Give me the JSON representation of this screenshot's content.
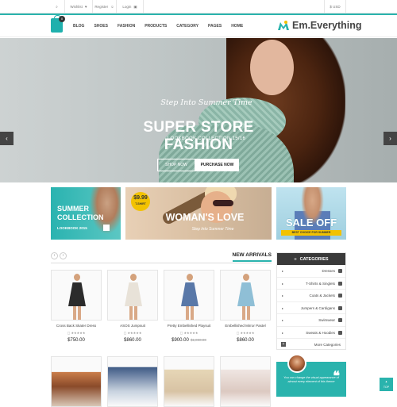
{
  "topbar": {
    "wishlist": "Wishlist",
    "register": "Register",
    "login": "Login",
    "currency": "$ USD"
  },
  "nav": {
    "cart_count": "0",
    "items": [
      "BLOG",
      "SHOES",
      "FASHION",
      "PRODUCTS",
      "CATEGORY",
      "PAGES",
      "HOME"
    ],
    "logo": "Em.Everything"
  },
  "hero": {
    "subtitle": "Step Into Summer Time",
    "title": "SUPER STORE FASHION",
    "collection": "LOOKBOOK COLLECTION 15/16",
    "shop_now": "SHOP NOW",
    "purchase_now": "PURCHASE NOW",
    "active_slide": 2,
    "slide_count": 3
  },
  "banners": {
    "summer": {
      "title_line1": "SUMMER",
      "title_line2": "COLLECTION",
      "subtitle": "LOOKBOOK 2015"
    },
    "woman": {
      "price": "$9.99",
      "price_label": "T-SHIRT",
      "title": "WOMAN'S LOVE",
      "subtitle": "Step Into Summer Time"
    },
    "sale": {
      "title": "SALE OFF",
      "subtitle": "BEST CHOICE FOR SUMMER"
    }
  },
  "section": {
    "title": "NEW ARRIVALS",
    "prev": "‹",
    "next": "›"
  },
  "products": [
    {
      "name": "Cross Back Skater Dress",
      "price": "$750.00",
      "old_price": "",
      "dress_color": "#2b2b2b"
    },
    {
      "name": "ASOS Jumpsuit",
      "price": "$860.00",
      "old_price": "",
      "dress_color": "#e8e2d8"
    },
    {
      "name": "Pretty Embellished Playsuit",
      "price": "$900.00",
      "old_price": "$1,000.00",
      "dress_color": "#5978a8"
    },
    {
      "name": "Embellished Mirror Pastel",
      "price": "$860.00",
      "old_price": "",
      "dress_color": "#8fbfd6"
    }
  ],
  "categories": {
    "title": "CATEGORIES",
    "items": [
      "Dresses",
      "T-Shirts & Singlets",
      "Coats & Jackets",
      "Jumpers & Cardigans",
      "Swimwear",
      "Sweats & Hoodies"
    ],
    "more": "More Categories"
  },
  "promo": {
    "text": "You can change the visual appearance of almost every element of this theme"
  },
  "totop": "TOP",
  "colors": {
    "accent": "#2ab3ad",
    "dark": "#3a3a3a",
    "yellow": "#f2c200"
  },
  "icons": [
    "search-icon",
    "heart-icon",
    "user-icon",
    "lock-icon",
    "bag-icon",
    "chevron-left-icon",
    "chevron-right-icon",
    "list-icon",
    "quote-icon"
  ]
}
